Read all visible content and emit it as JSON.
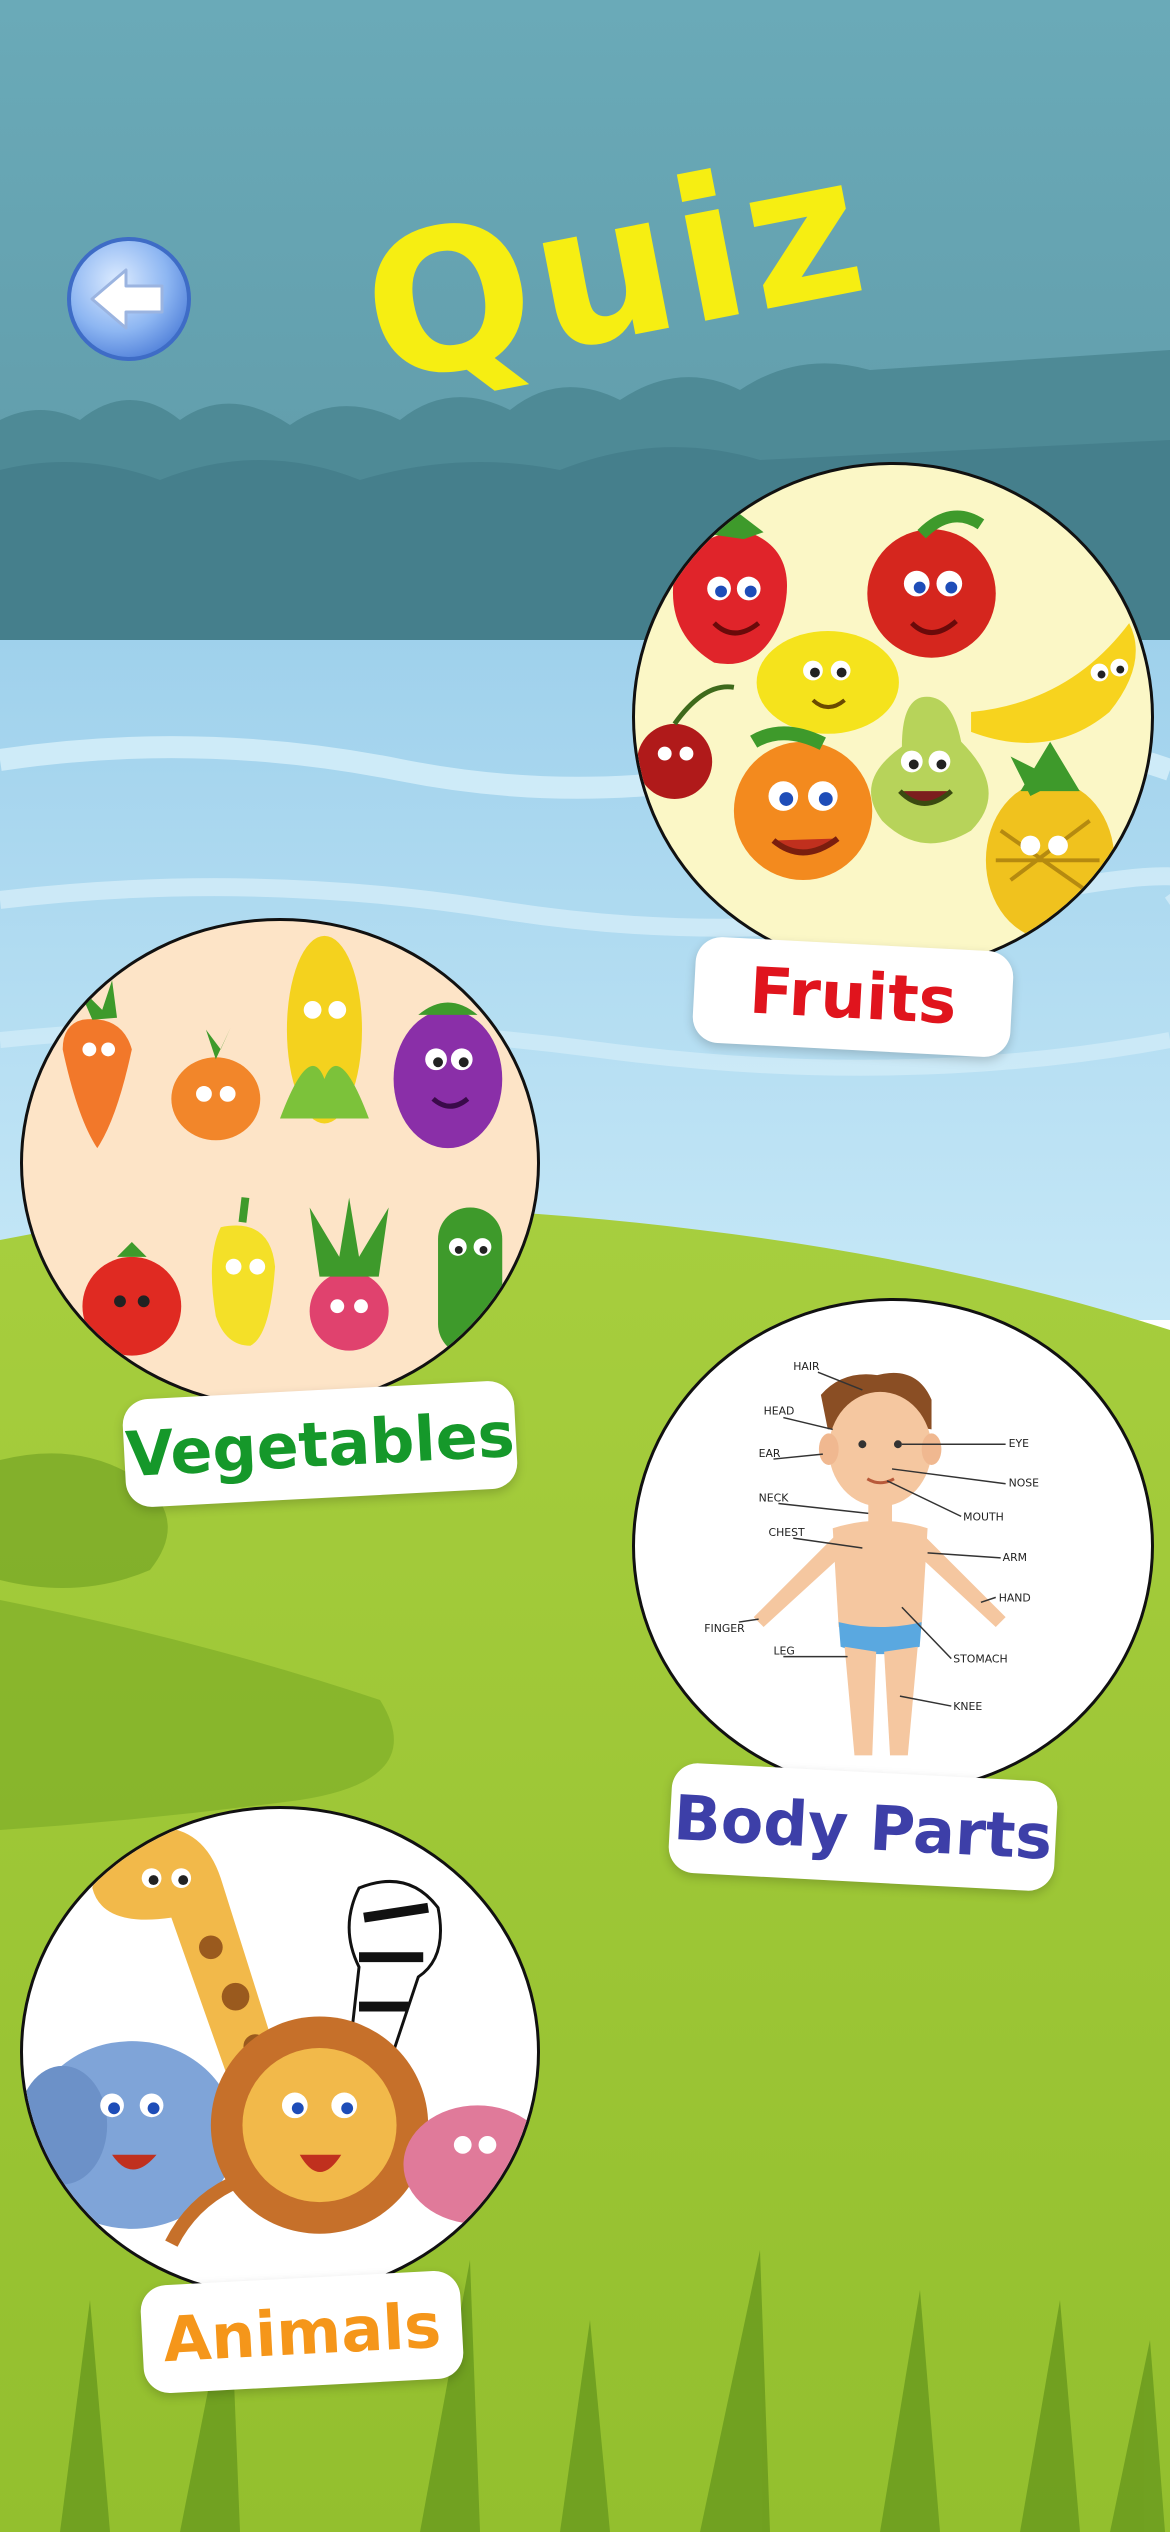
{
  "title": "Quiz",
  "back_button": {
    "icon": "back-arrow-icon"
  },
  "categories": [
    {
      "key": "fruits",
      "label": "Fruits",
      "color": "#E0141D"
    },
    {
      "key": "vegetables",
      "label": "Vegetables",
      "color": "#15982A"
    },
    {
      "key": "body-parts",
      "label": "Body Parts",
      "color": "#3D3FA8"
    },
    {
      "key": "animals",
      "label": "Animals",
      "color": "#F5961A"
    }
  ],
  "body_parts_diagram": {
    "labels": [
      "HAIR",
      "HEAD",
      "EAR",
      "NECK",
      "CHEST",
      "FINGER",
      "LEG",
      "EYE",
      "NOSE",
      "MOUTH",
      "ARM",
      "HAND",
      "STOMACH",
      "KNEE"
    ]
  },
  "colors": {
    "sky_top": "#6AAAB8",
    "water": "#A9D8F0",
    "grass": "#9FC93A",
    "title": "#F6EE12"
  }
}
